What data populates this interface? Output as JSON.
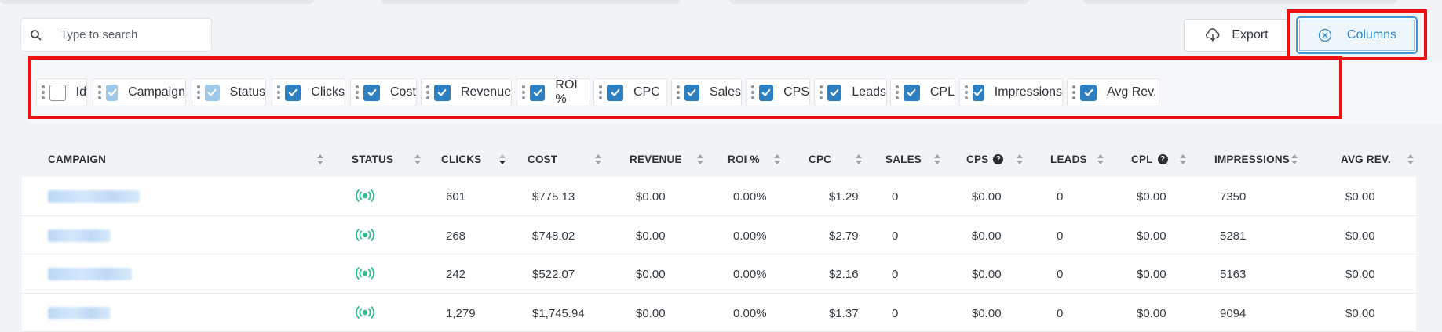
{
  "search": {
    "placeholder": "Type to search"
  },
  "toolbar": {
    "export_label": "Export",
    "columns_label": "Columns"
  },
  "chips": [
    {
      "label": "Id",
      "state": "off"
    },
    {
      "label": "Campaign",
      "state": "soft"
    },
    {
      "label": "Status",
      "state": "soft"
    },
    {
      "label": "Clicks",
      "state": "on"
    },
    {
      "label": "Cost",
      "state": "on"
    },
    {
      "label": "Revenue",
      "state": "on"
    },
    {
      "label": "ROI %",
      "state": "on"
    },
    {
      "label": "CPC",
      "state": "on"
    },
    {
      "label": "Sales",
      "state": "on"
    },
    {
      "label": "CPS",
      "state": "on"
    },
    {
      "label": "Leads",
      "state": "on"
    },
    {
      "label": "CPL",
      "state": "on"
    },
    {
      "label": "Impressions",
      "state": "on"
    },
    {
      "label": "Avg Rev.",
      "state": "on"
    }
  ],
  "table": {
    "headers": {
      "campaign": "CAMPAIGN",
      "status": "STATUS",
      "clicks": "CLICKS",
      "cost": "COST",
      "revenue": "REVENUE",
      "roi": "ROI %",
      "cpc": "CPC",
      "sales": "SALES",
      "cps": "CPS",
      "leads": "LEADS",
      "cpl": "CPL",
      "impressions": "IMPRESSIONS",
      "avg_rev": "AVG REV."
    },
    "help_badge": "?",
    "sorted_column": "clicks",
    "sort_direction": "desc",
    "rows": [
      {
        "clicks": "601",
        "cost": "$775.13",
        "revenue": "$0.00",
        "roi": "0.00%",
        "cpc": "$1.29",
        "sales": "0",
        "cps": "$0.00",
        "leads": "0",
        "cpl": "$0.00",
        "impressions": "7350",
        "avg_rev": "$0.00"
      },
      {
        "clicks": "268",
        "cost": "$748.02",
        "revenue": "$0.00",
        "roi": "0.00%",
        "cpc": "$2.79",
        "sales": "0",
        "cps": "$0.00",
        "leads": "0",
        "cpl": "$0.00",
        "impressions": "5281",
        "avg_rev": "$0.00"
      },
      {
        "clicks": "242",
        "cost": "$522.07",
        "revenue": "$0.00",
        "roi": "0.00%",
        "cpc": "$2.16",
        "sales": "0",
        "cps": "$0.00",
        "leads": "0",
        "cpl": "$0.00",
        "impressions": "5163",
        "avg_rev": "$0.00"
      },
      {
        "clicks": "1,279",
        "cost": "$1,745.94",
        "revenue": "$0.00",
        "roi": "0.00%",
        "cpc": "$1.37",
        "sales": "0",
        "cps": "$0.00",
        "leads": "0",
        "cpl": "$0.00",
        "impressions": "9094",
        "avg_rev": "$0.00"
      }
    ]
  },
  "colors": {
    "accent": "#2d88c9",
    "checkbox": "#2d7fc0",
    "status_active": "#2fbf8a",
    "highlight": "#ee1111"
  }
}
